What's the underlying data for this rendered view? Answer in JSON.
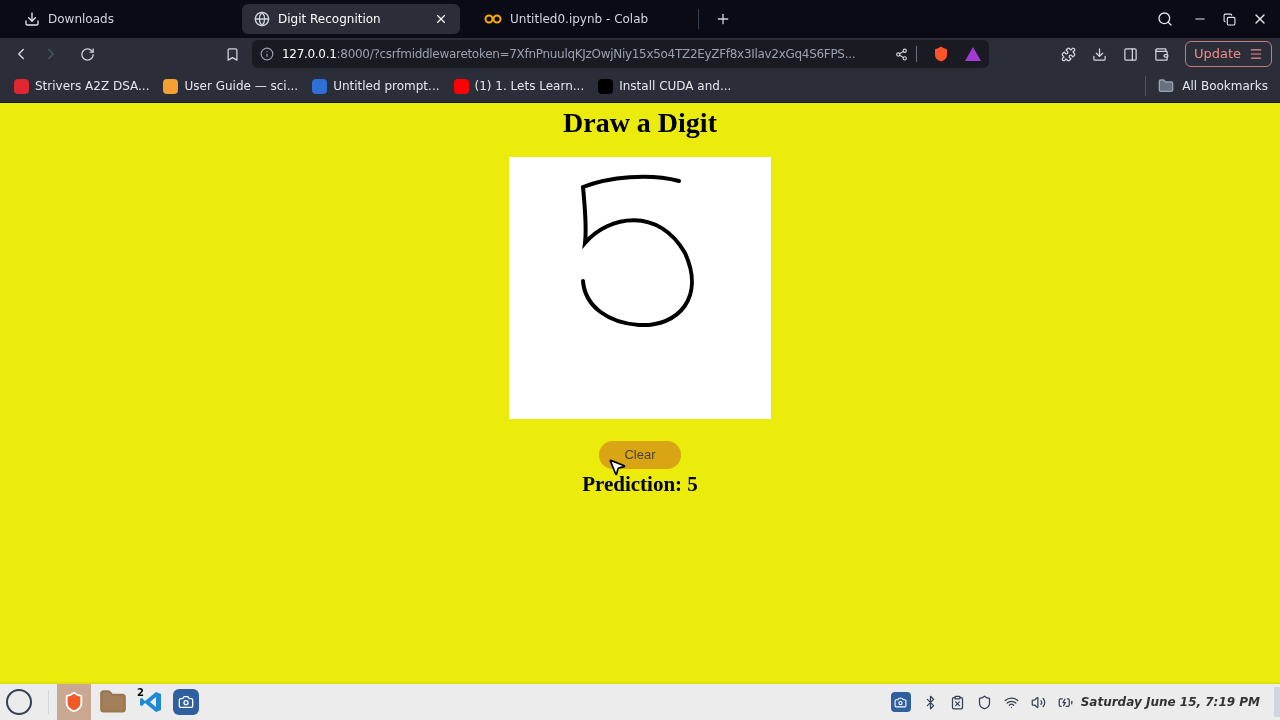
{
  "tabs": [
    {
      "kind": "download",
      "label": "Downloads",
      "selected": false
    },
    {
      "kind": "globe",
      "label": "Digit Recognition",
      "selected": true
    },
    {
      "kind": "colab",
      "label": "Untitled0.ipynb - Colab",
      "selected": false
    }
  ],
  "address": {
    "host": "127.0.0.1",
    "rest": ":8000/?csrfmiddlewaretoken=7XfnPnuulqKJzOwjNiy15x5o4TZ2EyZFf8x3Ilav2xGq4S6FPS..."
  },
  "update_button": "Update",
  "bookmarks": [
    {
      "label": "Strivers A2Z DSA...",
      "color": "#e0262f"
    },
    {
      "label": "User Guide — sci...",
      "color": "#f5a033"
    },
    {
      "label": "Untitled prompt...",
      "color": "#2f6fd8"
    },
    {
      "label": "(1) 1. Lets Learn...",
      "color": "#ff0000"
    },
    {
      "label": "Install CUDA and...",
      "color": "#000000"
    }
  ],
  "all_bookmarks": "All Bookmarks",
  "page": {
    "title": "Draw a Digit",
    "clear_button": "Clear",
    "prediction": "Prediction: 5"
  },
  "taskbar": {
    "code_badge": "2",
    "clock": "Saturday June 15, 7:19 PM"
  }
}
